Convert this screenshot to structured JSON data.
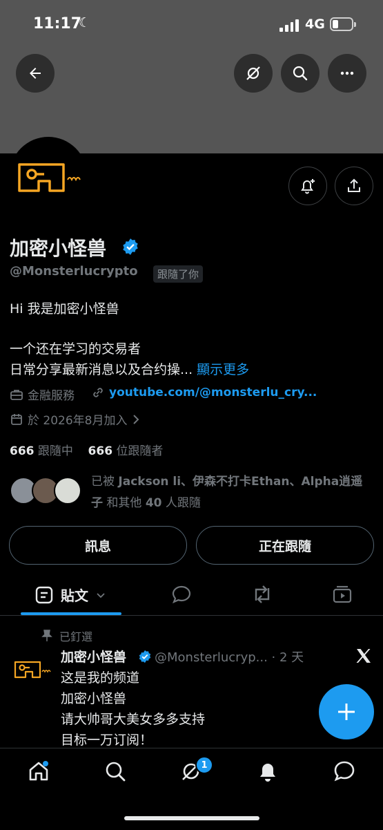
{
  "status_bar": {
    "time": "11:17",
    "network": "4G",
    "battery_level": 0.3
  },
  "profile": {
    "display_name": "加密小怪兽",
    "handle": "@Monsterlucrypto",
    "follows_you": "跟隨了你",
    "bio_line1": "Hi 我是加密小怪兽",
    "bio_line2": "一个还在学习的交易者",
    "bio_line3": "日常分享最新消息以及合约操...",
    "show_more": "顯示更多",
    "category": "金融服務",
    "website": "youtube.com/@monsterlu_cry...",
    "joined": "於 2026年8月加入",
    "following_count": "666",
    "following_label": "跟隨中",
    "followers_count": "666",
    "followers_label": "位跟隨者",
    "followed_by_prefix": "已被 ",
    "followed_by_names": "Jackson li、伊森不打卡Ethan、Alpha逍遥子",
    "followed_by_middle": " 和其他 ",
    "followed_by_count": "40",
    "followed_by_suffix": " 人跟隨"
  },
  "actions": {
    "message": "訊息",
    "following": "正在跟隨"
  },
  "tabs": {
    "posts": "貼文"
  },
  "pinned_post": {
    "pinned_label": "已釘選",
    "author": "加密小怪兽",
    "handle": "@Monsterlucryp...",
    "time": "· 2 天",
    "lines": [
      "这是我的频道",
      "加密小怪兽",
      "请大帅哥大美女多多支持",
      "目标一万订阅！"
    ]
  },
  "nav": {
    "messages_badge": "1"
  },
  "colors": {
    "accent": "#1d9bf0",
    "logo": "#f5a623",
    "banner": "#555555"
  },
  "icons": [
    "back-arrow-icon",
    "no-signal-icon",
    "search-icon",
    "more-icon",
    "bell-plus-icon",
    "share-icon",
    "verified-badge-icon",
    "briefcase-icon",
    "link-icon",
    "calendar-icon",
    "chevron-right-icon",
    "posts-icon",
    "chevron-down-icon",
    "reply-icon",
    "repost-icon",
    "media-icon",
    "pin-icon",
    "x-logo-icon",
    "plus-icon",
    "home-icon",
    "grok-icon",
    "notifications-icon",
    "messages-icon"
  ]
}
